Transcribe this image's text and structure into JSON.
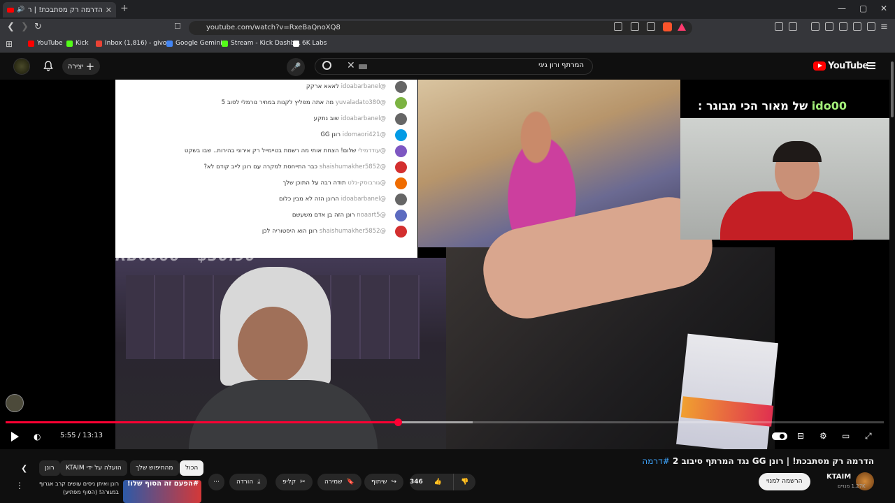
{
  "browser": {
    "tab_title": "הדרמה רק מסתבכת! | רונן GG",
    "new_tab": "+",
    "window_controls": [
      "—",
      "▢",
      "✕"
    ],
    "url": "youtube.com/watch?v=RxeBaQnoXQ8",
    "bookmarks": [
      {
        "label": "YouTube",
        "color": "#ff0000"
      },
      {
        "label": "Kick",
        "color": "#53fc18"
      },
      {
        "label": "Inbox (1,816) - givo...",
        "color": "#ea4335"
      },
      {
        "label": "Google Gemini",
        "color": "#4285f4"
      },
      {
        "label": "Stream - Kick Dashb...",
        "color": "#53fc18"
      },
      {
        "label": "6K Labs",
        "color": "#ffffff"
      }
    ]
  },
  "header": {
    "logo": "YouTube",
    "search_value": "המרתף ורון גיגי",
    "create_label": "יצירה"
  },
  "player": {
    "chat_messages": [
      {
        "user": "@idoabarbanel",
        "text": "לאאא ארקק",
        "avatar": "#666666"
      },
      {
        "user": "@yuvaladato380",
        "text": "מה אתה מפליץ לקנות במחיר נורמלי לסוב 5",
        "avatar": "#7cb342"
      },
      {
        "user": "@idoabarbanel",
        "text": "שוב נתקע",
        "avatar": "#666666"
      },
      {
        "user": "@idomaori421",
        "text": "רונן GG",
        "avatar": "#039be5"
      },
      {
        "user": "@עודדמילי",
        "text": "שלום! הצחת אותי מה רשמת בטיימייל רק אירוני בהירות.. שבו בשקט",
        "avatar": "#7e57c2"
      },
      {
        "user": "@shaishumakher5852",
        "text": "כבר התייחסת למקרה עם רונן לייב קודם לא?",
        "avatar": "#d32f2f"
      },
      {
        "user": "@גורבוסק-נלט",
        "text": "תודה רבה על התוכן שלך",
        "avatar": "#ef6c00"
      },
      {
        "user": "@idoabarbanel",
        "text": "הרונן הזה לא מבין כלום",
        "avatar": "#666666"
      },
      {
        "user": "@noaart5",
        "text": "רונן הזה בן אדם משעשם",
        "avatar": "#5c6bc0"
      },
      {
        "user": "@shaishumakher5852",
        "text": "רונן הוא היסטוריה לכן",
        "avatar": "#d32f2f"
      }
    ],
    "donation_text": "RB6666 - $30.90",
    "webcam_caption_prefix": "של מאור הכי מבוגר :",
    "webcam_caption_name": "ido00",
    "progress_fraction": 0.447,
    "buffered_fraction": 0.532,
    "current_time": "5:55",
    "duration": "13:13",
    "time_display": "5:55 / 13:13"
  },
  "chips": [
    "הכול",
    "מהחיפוש שלך",
    "הועלה על ידי KTAIM",
    "רונן"
  ],
  "video": {
    "title": "הדרמה רק מסתבכת! | רונן GG נגד המרתף סיבוב 2",
    "hashtag": "#דרמה",
    "channel": "KTAIM",
    "subscribers": "1.27K מנויים",
    "subscribe_label": "הרשמה למנוי",
    "likes": "346",
    "share_label": "שיתוף",
    "save_label": "שמירה",
    "clip_label": "קליפ",
    "download_label": "הורדה"
  },
  "recommendation": {
    "thumb_text": "#הפעם זה הסוף שלו!",
    "title": "רונן ואיתן ניסים עושים קרב אגרוף במגורה! (הסוף מפתיע)"
  }
}
